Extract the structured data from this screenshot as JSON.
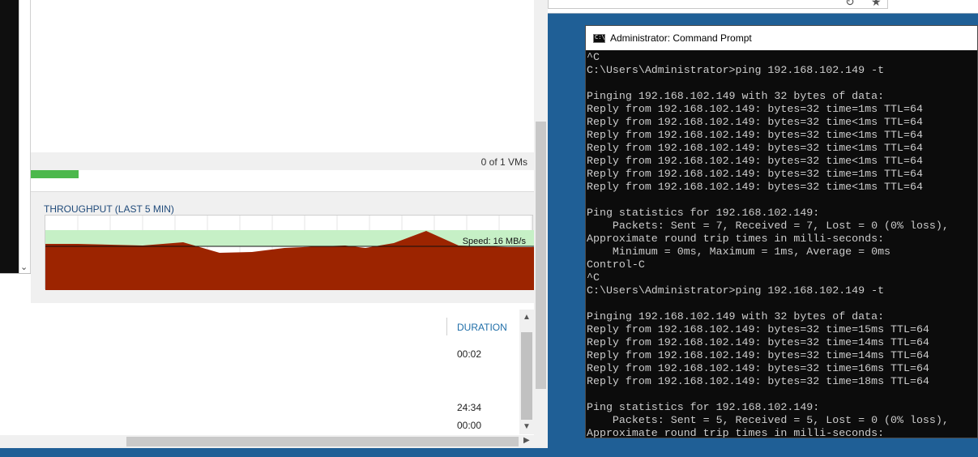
{
  "backup_app": {
    "vm_count": "0 of 1 VMs",
    "vm_progress": 0.095,
    "throughput": {
      "title": "THROUGHPUT (LAST 5 MIN)",
      "speed_label": "Speed: 16 MB/s",
      "colors": {
        "area": "#9c2400",
        "band": "#c6f0c6",
        "speed_line": "#111111"
      }
    },
    "list": {
      "duration_header": "DURATION",
      "durations": [
        "00:02",
        "24:34",
        "00:00"
      ]
    }
  },
  "cmd": {
    "title": "Administrator: Command Prompt",
    "icon_label": "C:\\",
    "lines": [
      "^C",
      "C:\\Users\\Administrator>ping 192.168.102.149 -t",
      "",
      "Pinging 192.168.102.149 with 32 bytes of data:",
      "Reply from 192.168.102.149: bytes=32 time=1ms TTL=64",
      "Reply from 192.168.102.149: bytes=32 time<1ms TTL=64",
      "Reply from 192.168.102.149: bytes=32 time<1ms TTL=64",
      "Reply from 192.168.102.149: bytes=32 time<1ms TTL=64",
      "Reply from 192.168.102.149: bytes=32 time<1ms TTL=64",
      "Reply from 192.168.102.149: bytes=32 time=1ms TTL=64",
      "Reply from 192.168.102.149: bytes=32 time<1ms TTL=64",
      "",
      "Ping statistics for 192.168.102.149:",
      "    Packets: Sent = 7, Received = 7, Lost = 0 (0% loss),",
      "Approximate round trip times in milli-seconds:",
      "    Minimum = 0ms, Maximum = 1ms, Average = 0ms",
      "Control-C",
      "^C",
      "C:\\Users\\Administrator>ping 192.168.102.149 -t",
      "",
      "Pinging 192.168.102.149 with 32 bytes of data:",
      "Reply from 192.168.102.149: bytes=32 time=15ms TTL=64",
      "Reply from 192.168.102.149: bytes=32 time=14ms TTL=64",
      "Reply from 192.168.102.149: bytes=32 time=14ms TTL=64",
      "Reply from 192.168.102.149: bytes=32 time=16ms TTL=64",
      "Reply from 192.168.102.149: bytes=32 time=18ms TTL=64",
      "",
      "Ping statistics for 192.168.102.149:",
      "    Packets: Sent = 5, Received = 5, Lost = 0 (0% loss),",
      "Approximate round trip times in milli-seconds:"
    ]
  }
}
